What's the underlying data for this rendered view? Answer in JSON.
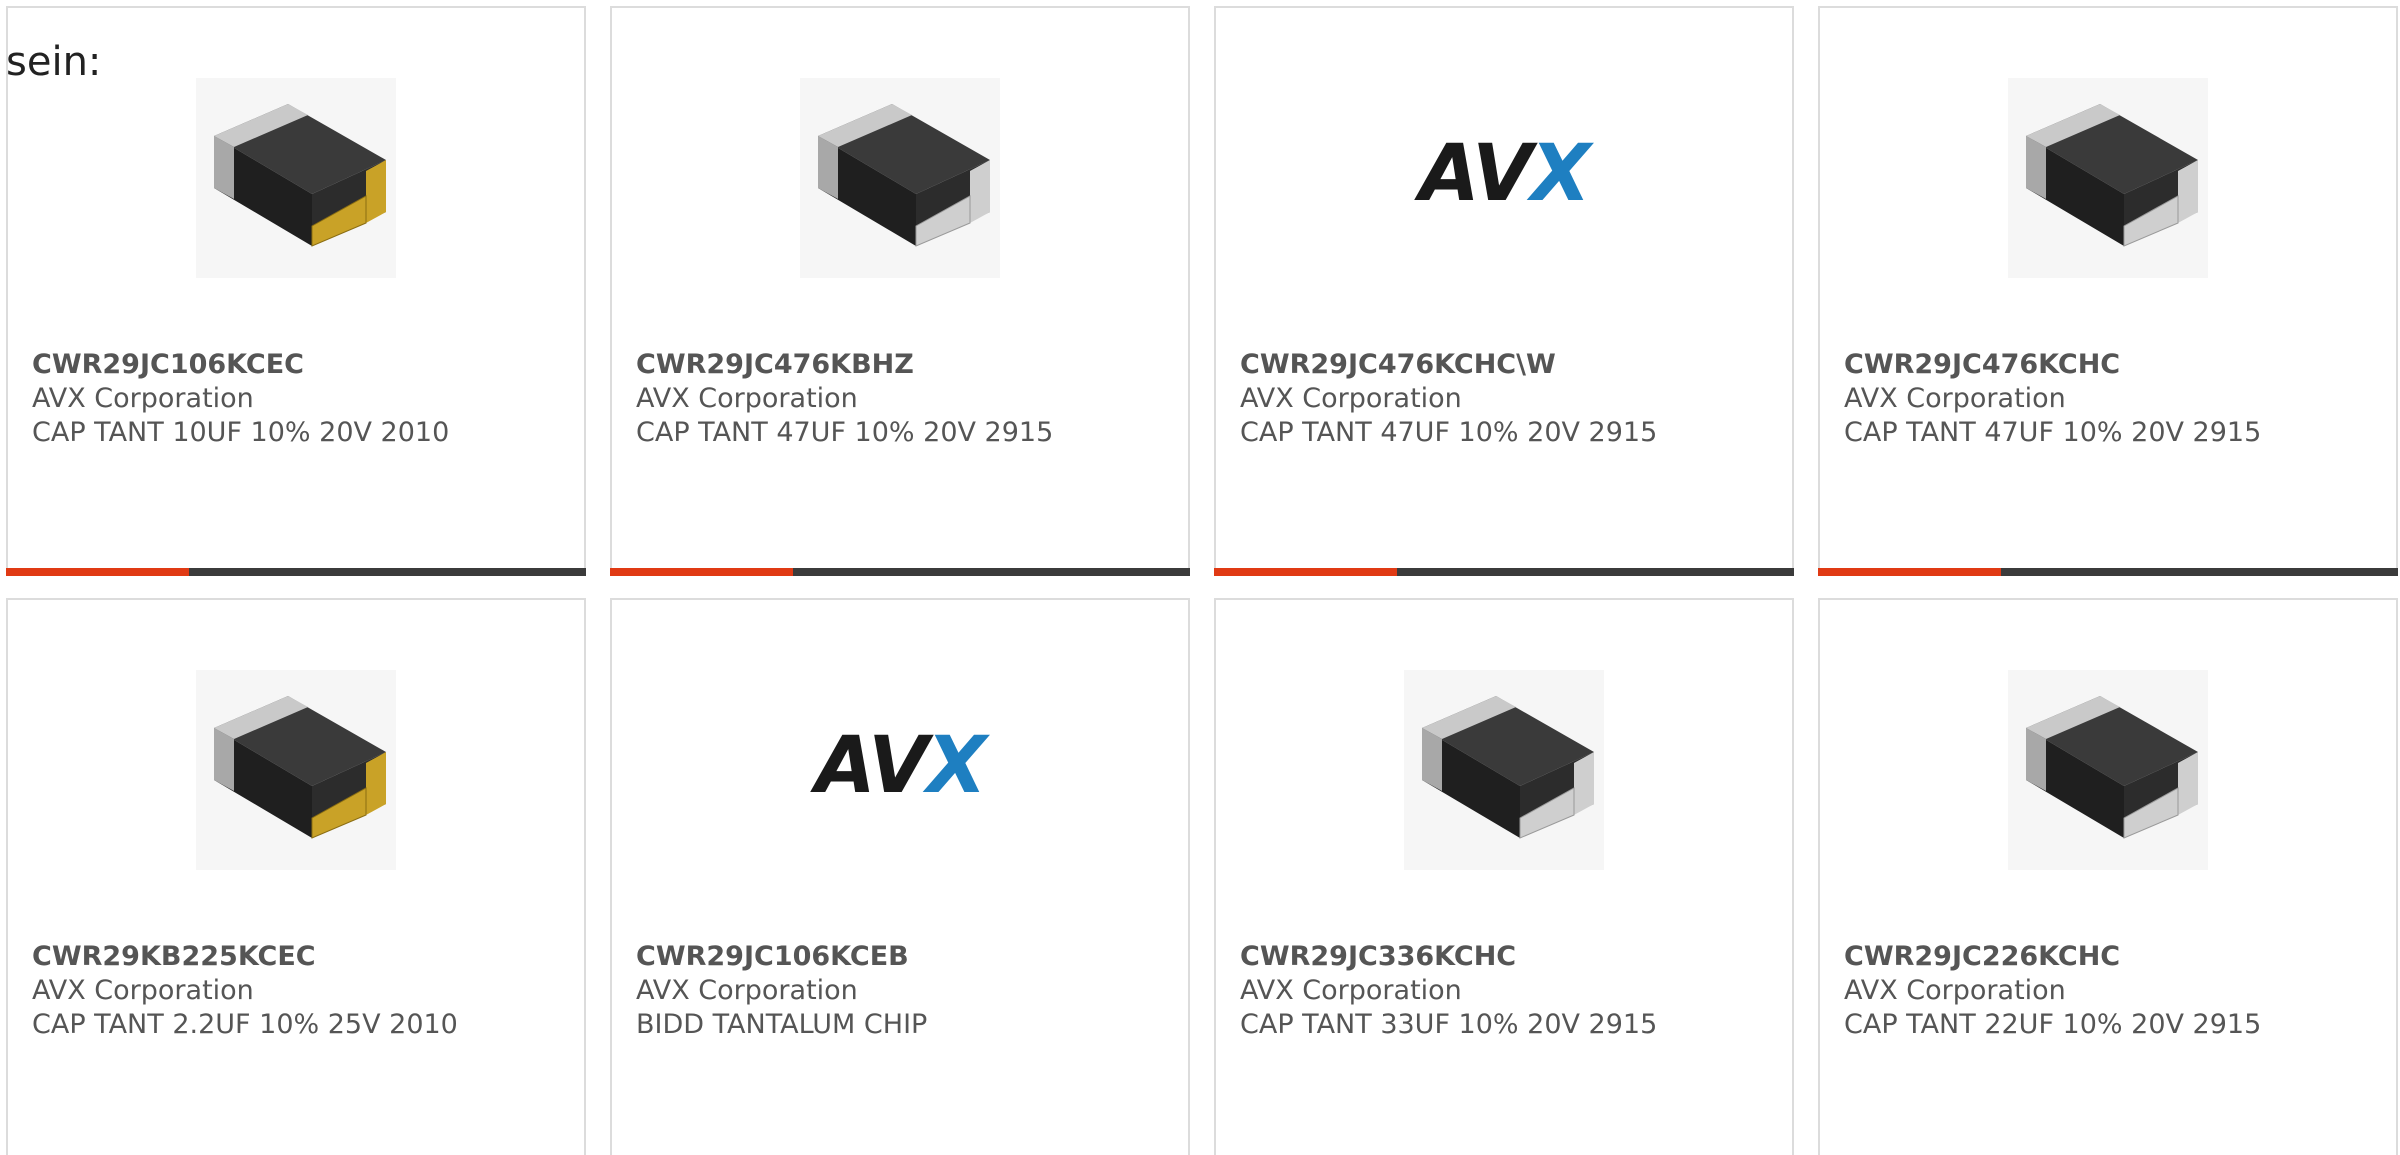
{
  "intro_text": "sein:",
  "accent_color": "#e03a14",
  "bar_color": "#3b3b3b",
  "products": [
    {
      "part_number": "CWR29JC106KCEC",
      "manufacturer": "AVX Corporation",
      "description": "CAP TANT 10UF 10% 20V 2010",
      "image": "gold-chip"
    },
    {
      "part_number": "CWR29JC476KBHZ",
      "manufacturer": "AVX Corporation",
      "description": "CAP TANT 47UF 10% 20V 2915",
      "image": "silver-chip"
    },
    {
      "part_number": "CWR29JC476KCHC\\W",
      "manufacturer": "AVX Corporation",
      "description": "CAP TANT 47UF 10% 20V 2915",
      "image": "avx-logo",
      "logo_text": "AVX"
    },
    {
      "part_number": "CWR29JC476KCHC",
      "manufacturer": "AVX Corporation",
      "description": "CAP TANT 47UF 10% 20V 2915",
      "image": "silver-chip"
    },
    {
      "part_number": "CWR29KB225KCEC",
      "manufacturer": "AVX Corporation",
      "description": "CAP TANT 2.2UF 10% 25V 2010",
      "image": "gold-chip"
    },
    {
      "part_number": "CWR29JC106KCEB",
      "manufacturer": "AVX Corporation",
      "description": "BIDD TANTALUM CHIP",
      "image": "avx-logo",
      "logo_text": "AVX"
    },
    {
      "part_number": "CWR29JC336KCHC",
      "manufacturer": "AVX Corporation",
      "description": "CAP TANT 33UF 10% 20V 2915",
      "image": "silver-chip"
    },
    {
      "part_number": "CWR29JC226KCHC",
      "manufacturer": "AVX Corporation",
      "description": "CAP TANT 22UF 10% 20V 2915",
      "image": "silver-chip"
    }
  ]
}
